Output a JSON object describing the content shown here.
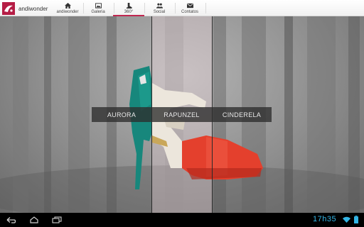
{
  "app": {
    "brand": "andiwonder"
  },
  "tabs": [
    {
      "label": "andiwonder",
      "icon": "home-icon"
    },
    {
      "label": "Galeria",
      "icon": "image-icon"
    },
    {
      "label": "360°",
      "icon": "boot-icon",
      "active": true
    },
    {
      "label": "Social",
      "icon": "people-icon"
    },
    {
      "label": "Contatos",
      "icon": "mail-icon"
    }
  ],
  "product_labels": [
    "AURORA",
    "RAPUNZEL",
    "CINDERELA"
  ],
  "system_bar": {
    "clock": "17h35",
    "icons": [
      "back-icon",
      "home-icon",
      "recent-apps-icon",
      "wifi-icon",
      "battery-icon"
    ]
  },
  "colors": {
    "accent": "#c0264f",
    "clock": "#33b5e5",
    "aurora_teal": "#17877c",
    "cinderela_red": "#e4402d",
    "rapunzel_cream": "#ece6dc"
  }
}
